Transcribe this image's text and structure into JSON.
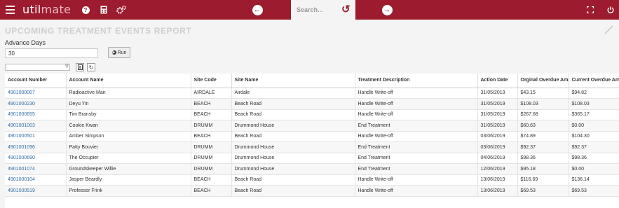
{
  "app": {
    "logo_main": "util",
    "logo_rest": "mate"
  },
  "search": {
    "placeholder": "Search..."
  },
  "report": {
    "title": "UPCOMING TREATMENT EVENTS REPORT"
  },
  "params": {
    "advance_days_label": "Advance Days",
    "advance_days_value": "30",
    "run_label": "Run"
  },
  "grid": {
    "columns": [
      "Account Number",
      "Account Name",
      "Site Code",
      "Site Name",
      "Treatment Description",
      "Action Date",
      "Orginal Overdue Amount",
      "Current Overdue Amount"
    ],
    "rows": [
      [
        "4901000007",
        "Radioactive Man",
        "AIRDALE",
        "Airdale",
        "Handle Write-off",
        "31/05/2019",
        "$43.15",
        "$94.82"
      ],
      [
        "4901000230",
        "Deyu Yin",
        "BEACH",
        "Beach Road",
        "Handle Write-off",
        "31/05/2019",
        "$108.03",
        "$108.03"
      ],
      [
        "4901000655",
        "Tim Bransby",
        "BEACH",
        "Beach Road",
        "Handle Write-off",
        "31/05/2019",
        "$267.68",
        "$365.17"
      ],
      [
        "4901001003",
        "Cookie Kwan",
        "DRUMM",
        "Drummond House",
        "End Treatment",
        "31/05/2019",
        "$60.63",
        "$0.00"
      ],
      [
        "4901000501",
        "Amber Simpson",
        "BEACH",
        "Beach Road",
        "Handle Write-off",
        "03/06/2019",
        "$74.89",
        "$104.30"
      ],
      [
        "4901001096",
        "Patty Bouvier",
        "DRUMM",
        "Drummond House",
        "End Treatment",
        "03/06/2019",
        "$92.37",
        "$92.37"
      ],
      [
        "4901000690",
        "The Occupier",
        "DRUMM",
        "Drummond House",
        "End Treatment",
        "04/06/2019",
        "$98.36",
        "$98.36"
      ],
      [
        "4901001074",
        "Groundskeeper Willie",
        "DRUMM",
        "Drummond House",
        "End Treatment",
        "12/06/2019",
        "$95.18",
        "$0.00"
      ],
      [
        "4901000104",
        "Jasper Beardly",
        "BEACH",
        "Beach Road",
        "Handle Write-off",
        "13/06/2019",
        "$116.69",
        "$136.14"
      ],
      [
        "4901000519",
        "Professor Frink",
        "BEACH",
        "Beach Road",
        "Handle Write-off",
        "13/06/2019",
        "$69.53",
        "$69.53"
      ]
    ]
  },
  "colors": {
    "brand": "#9c1b2e",
    "link": "#2f6ea8"
  },
  "icons": [
    "menu-icon",
    "help-icon",
    "calculator-icon",
    "settings-icon",
    "back-arrow-icon",
    "undo-icon",
    "forward-arrow-icon",
    "fullscreen-icon",
    "power-icon",
    "edit-icon",
    "search-icon",
    "export-icon",
    "refresh-icon",
    "play-icon"
  ]
}
